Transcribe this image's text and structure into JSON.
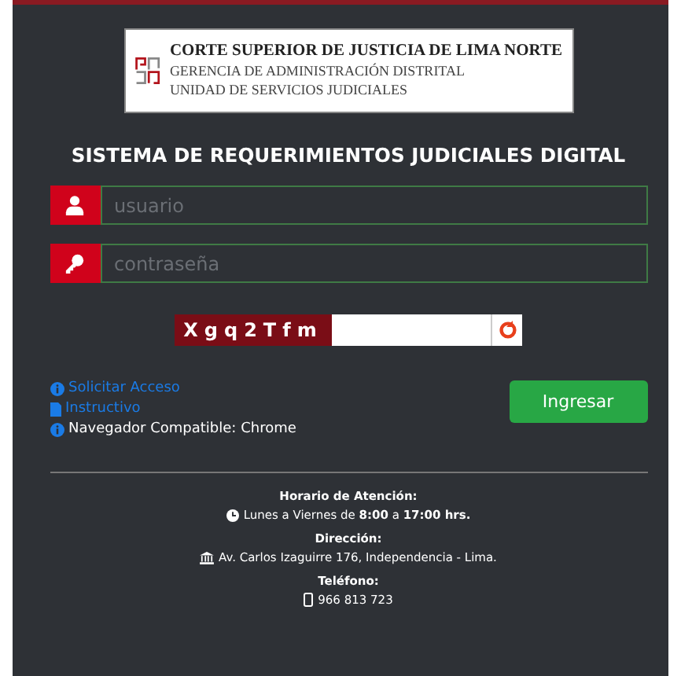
{
  "logo": {
    "lines": [
      "CORTE SUPERIOR DE JUSTICIA DE LIMA NORTE",
      "GERENCIA DE ADMINISTRACIÓN DISTRITAL",
      "UNIDAD DE SERVICIOS JUDICIALES"
    ]
  },
  "title": "SISTEMA DE REQUERIMIENTOS JUDICIALES DIGITAL",
  "fields": [
    {
      "kind": "user",
      "placeholder": "usuario"
    },
    {
      "kind": "key",
      "placeholder": "contraseña"
    }
  ],
  "captcha": {
    "code": "Xgq2Tfm"
  },
  "links": [
    {
      "kind": "info",
      "label": "Solicitar Acceso"
    },
    {
      "kind": "file",
      "label": "Instructivo"
    }
  ],
  "note": "Navegador Compatible: Chrome",
  "login_button": "Ingresar",
  "footer": [
    {
      "kind": "clock",
      "heading": "Horario de Atención:",
      "text": "Lunes a Viernes de **8:00** a **17:00 hrs.**"
    },
    {
      "kind": "bank",
      "heading": "Dirección:",
      "text": "Av. Carlos Izaguirre 176, Independencia - Lima."
    },
    {
      "kind": "phone",
      "heading": "Teléfono:",
      "text": "966 813 723"
    }
  ]
}
